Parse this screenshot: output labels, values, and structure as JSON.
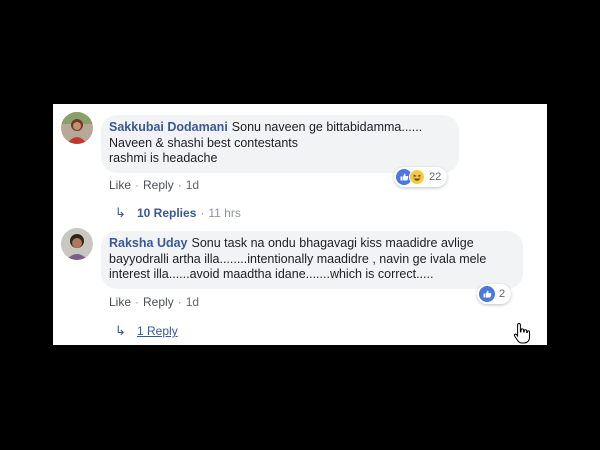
{
  "comments": [
    {
      "author": "Sakkubai Dodamani",
      "lines": [
        "Sonu naveen ge bittabidamma......",
        "Naveen & shashi best contestants",
        "rashmi is headache"
      ],
      "actions": {
        "like": "Like",
        "reply": "Reply",
        "time": "1d"
      },
      "reactions": {
        "count": "22",
        "icons": [
          "like-icon",
          "haha-icon"
        ]
      },
      "replies": {
        "label": "10 Replies",
        "time": "11 hrs"
      }
    },
    {
      "author": "Raksha Uday",
      "lines": [
        "Sonu task na ondu bhagavagi kiss maadidre avlige",
        "bayyodralli artha illa........intentionally maadidre , navin ge ivala mele",
        "interest illa......avoid maadtha idane.......which is correct....."
      ],
      "actions": {
        "like": "Like",
        "reply": "Reply",
        "time": "1d"
      },
      "reactions": {
        "count": "2",
        "icons": [
          "like-icon"
        ]
      },
      "replies": {
        "label": "1 Reply",
        "time": ""
      }
    }
  ],
  "colors": {
    "name": "#385898",
    "bubble": "#f2f3f5",
    "like": "#4a77e0"
  }
}
